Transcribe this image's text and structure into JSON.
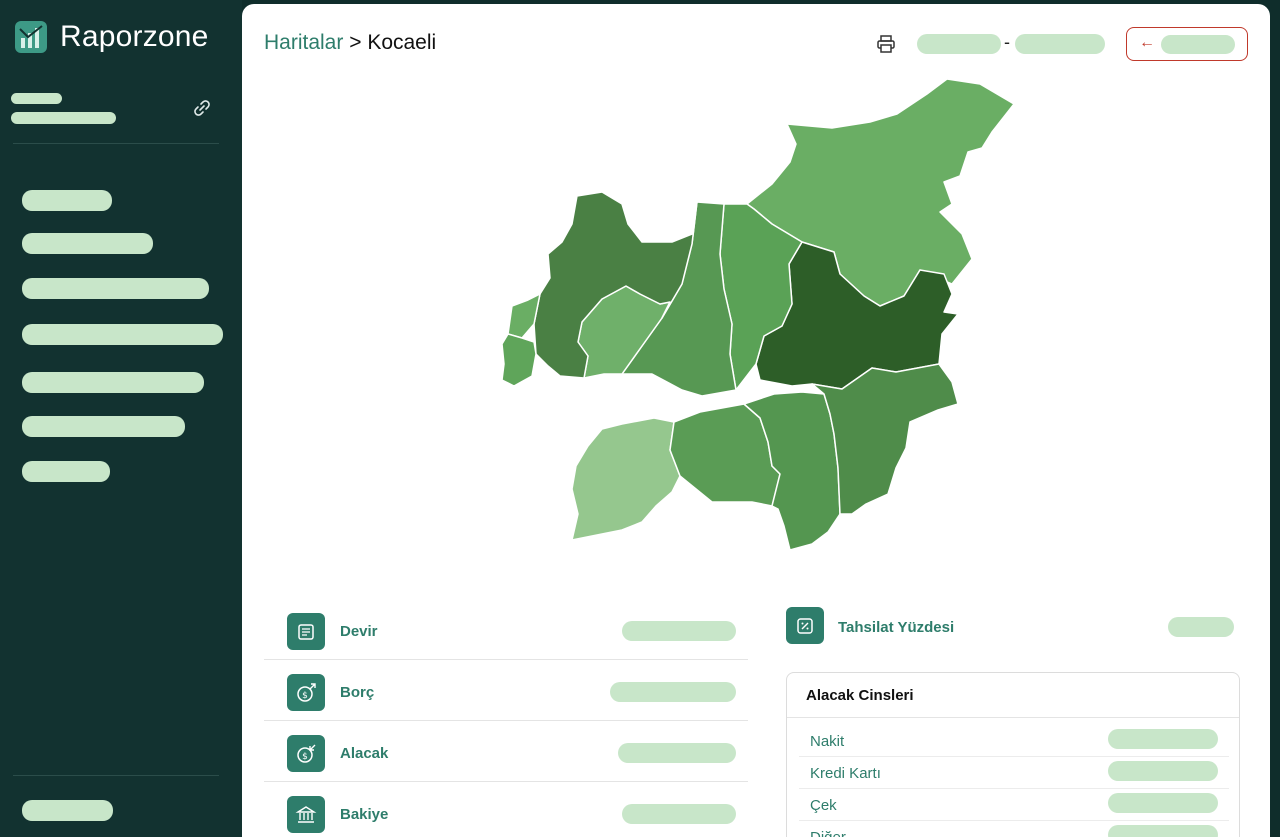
{
  "app": {
    "name": "Raporzone"
  },
  "breadcrumb": {
    "parent": "Haritalar",
    "separator": ">",
    "current": "Kocaeli"
  },
  "header": {
    "date_separator": "-",
    "back_arrow": "←"
  },
  "icons": {
    "link": "link-icon",
    "print": "printer-icon",
    "back": "arrow-left-icon",
    "devir": "ledger-icon",
    "borc": "dollar-out-icon",
    "alacak": "dollar-in-icon",
    "bakiye": "bank-icon",
    "tahsilat": "percent-icon"
  },
  "colors": {
    "accent": "#2e7d6b",
    "sidebar": "#123230",
    "placeholder": "#c8e6c9",
    "danger": "#c0392b"
  },
  "stats": [
    {
      "label": "Devir"
    },
    {
      "label": "Borç"
    },
    {
      "label": "Alacak"
    },
    {
      "label": "Bakiye"
    }
  ],
  "tahsilat": {
    "label": "Tahsilat Yüzdesi"
  },
  "alacak_cinsleri": {
    "title": "Alacak Cinsleri",
    "rows": [
      {
        "label": "Nakit"
      },
      {
        "label": "Kredi Kartı"
      },
      {
        "label": "Çek"
      },
      {
        "label": "Diğer"
      }
    ]
  }
}
